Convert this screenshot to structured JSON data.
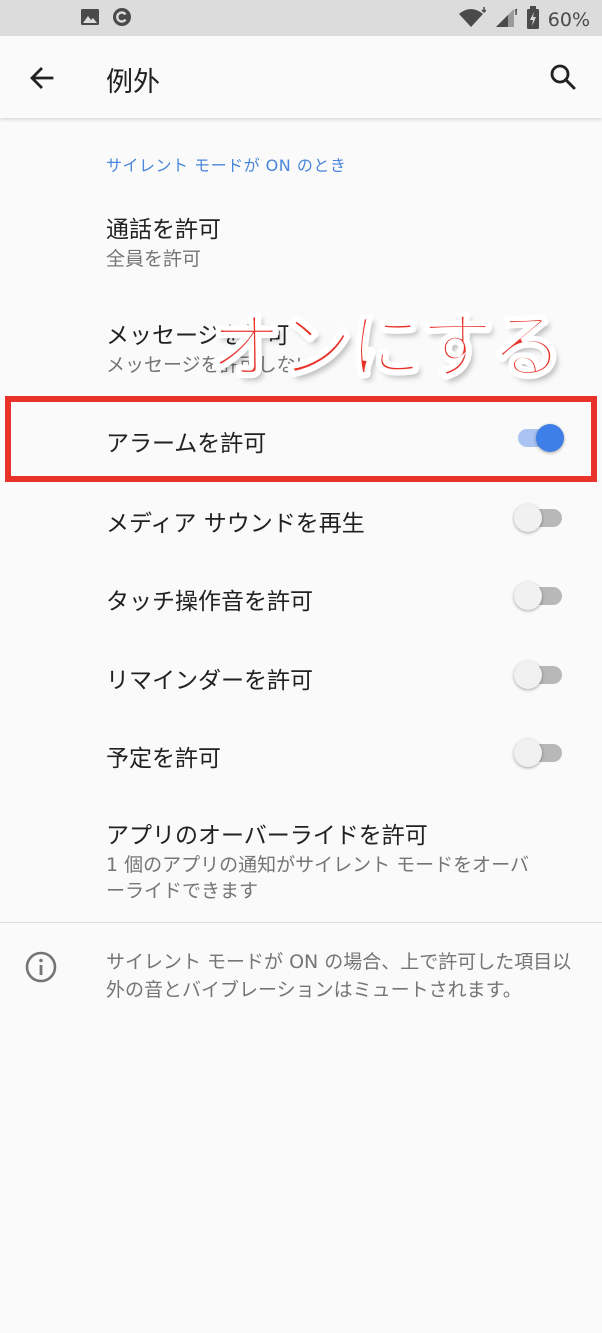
{
  "status_bar": {
    "left_icons": [
      "image-icon",
      "c-app-icon"
    ],
    "right_icons": [
      "wifi-icon",
      "signal-icon",
      "battery-charging-icon"
    ],
    "battery_text": "60%"
  },
  "app_bar": {
    "back_icon": "arrow-back-icon",
    "title": "例外",
    "search_icon": "search-icon"
  },
  "section_header": "サイレント モードが ON のとき",
  "rows": [
    {
      "title": "通話を許可",
      "subtitle": "全員を許可"
    },
    {
      "title": "メッセージを許可",
      "subtitle": "メッセージを許可しない"
    },
    {
      "title": "アラームを許可",
      "toggle_on": true
    },
    {
      "title": "メディア サウンドを再生",
      "toggle_on": false
    },
    {
      "title": "タッチ操作音を許可",
      "toggle_on": false
    },
    {
      "title": "リマインダーを許可",
      "toggle_on": false
    },
    {
      "title": "予定を許可",
      "toggle_on": false
    },
    {
      "title": "アプリのオーバーライドを許可",
      "subtitle_line1": "1 個のアプリの通知がサイレント モードをオーバ",
      "subtitle_line2": "ーライドできます"
    }
  ],
  "annotation": "オンにする",
  "info": {
    "icon": "info-icon",
    "text": "サイレント モードが ON の場合、上で許可した項目以外の音とバイブレーションはミュートされます。"
  },
  "colors": {
    "accent": "#4a86d9",
    "toggle_on": "#3d7fe6",
    "annotation_red": "#e8322a"
  }
}
